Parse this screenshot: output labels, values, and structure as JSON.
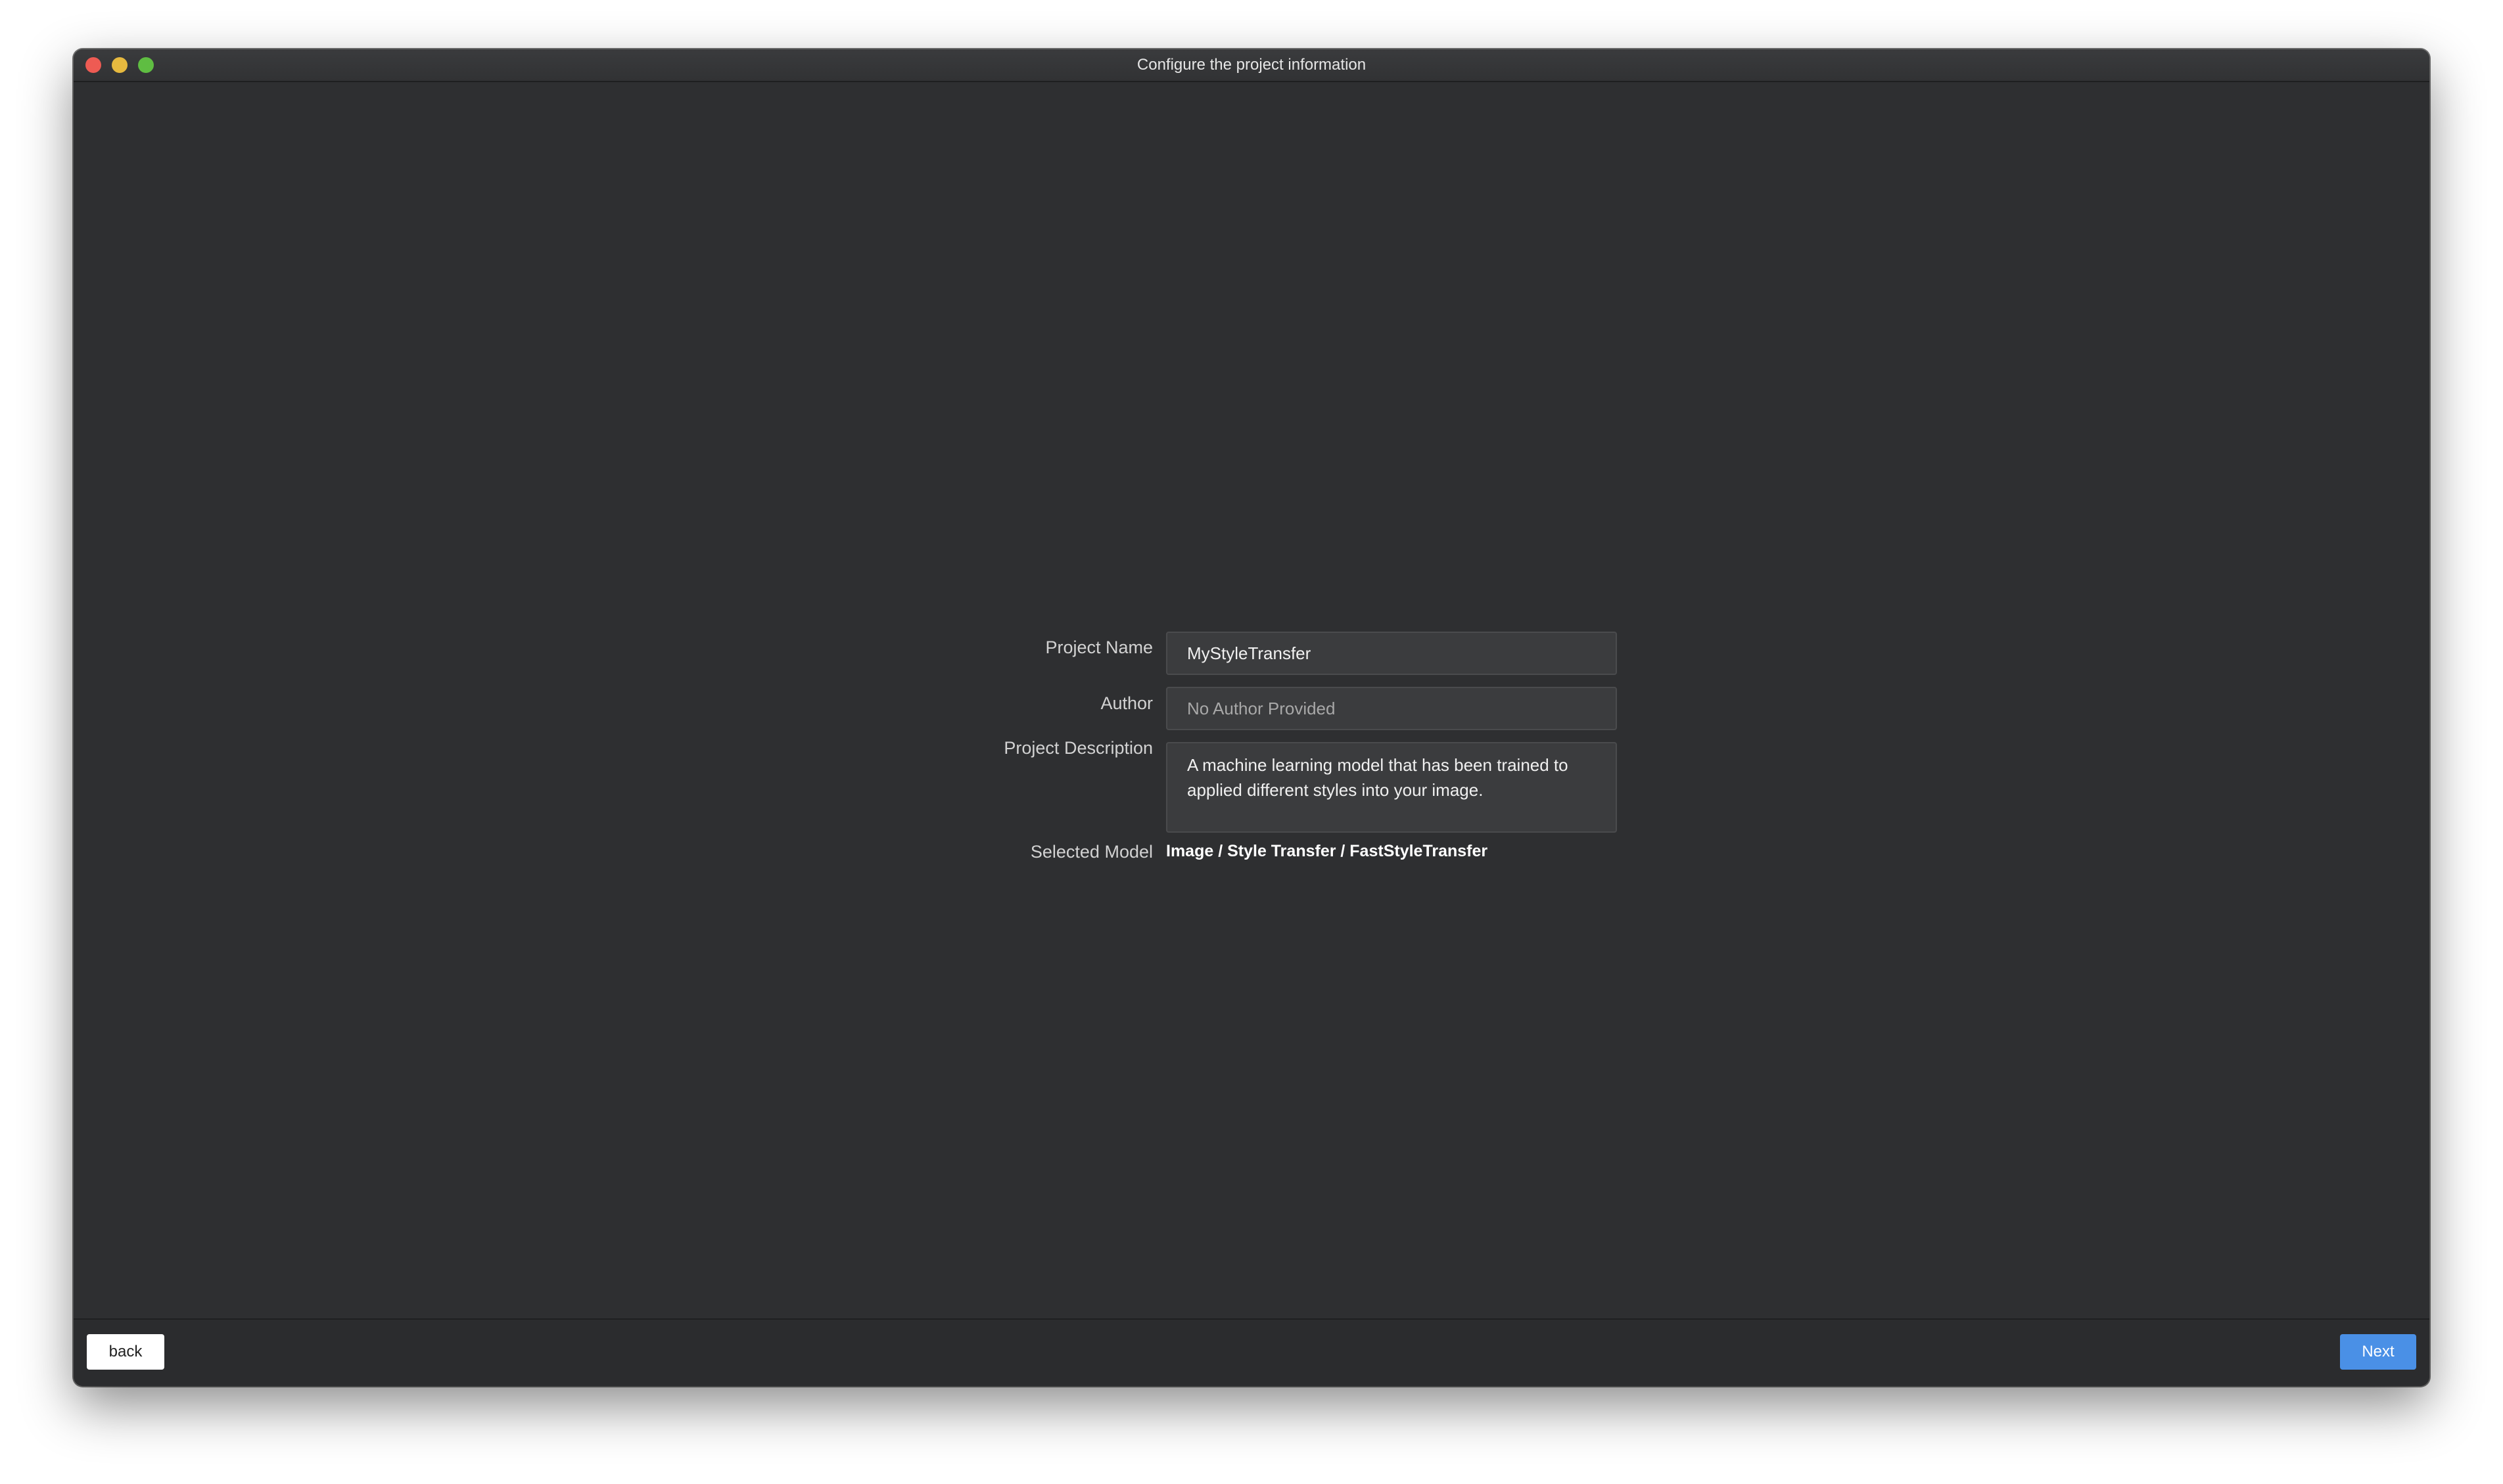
{
  "window": {
    "title": "Configure the project information"
  },
  "form": {
    "project_name": {
      "label": "Project Name",
      "value": "MyStyleTransfer"
    },
    "author": {
      "label": "Author",
      "placeholder": "No Author Provided",
      "value": ""
    },
    "description": {
      "label": "Project Description",
      "value": "A machine learning model that has been trained to applied different styles into your image."
    },
    "selected_model": {
      "label": "Selected Model",
      "value": "Image / Style Transfer / FastStyleTransfer"
    }
  },
  "footer": {
    "back_label": "back",
    "next_label": "Next"
  },
  "colors": {
    "background": "#2e2f31",
    "accent": "#4a90e6",
    "traffic_close": "#ee5b53",
    "traffic_minimize": "#e6b93f",
    "traffic_maximize": "#5fbd42"
  }
}
